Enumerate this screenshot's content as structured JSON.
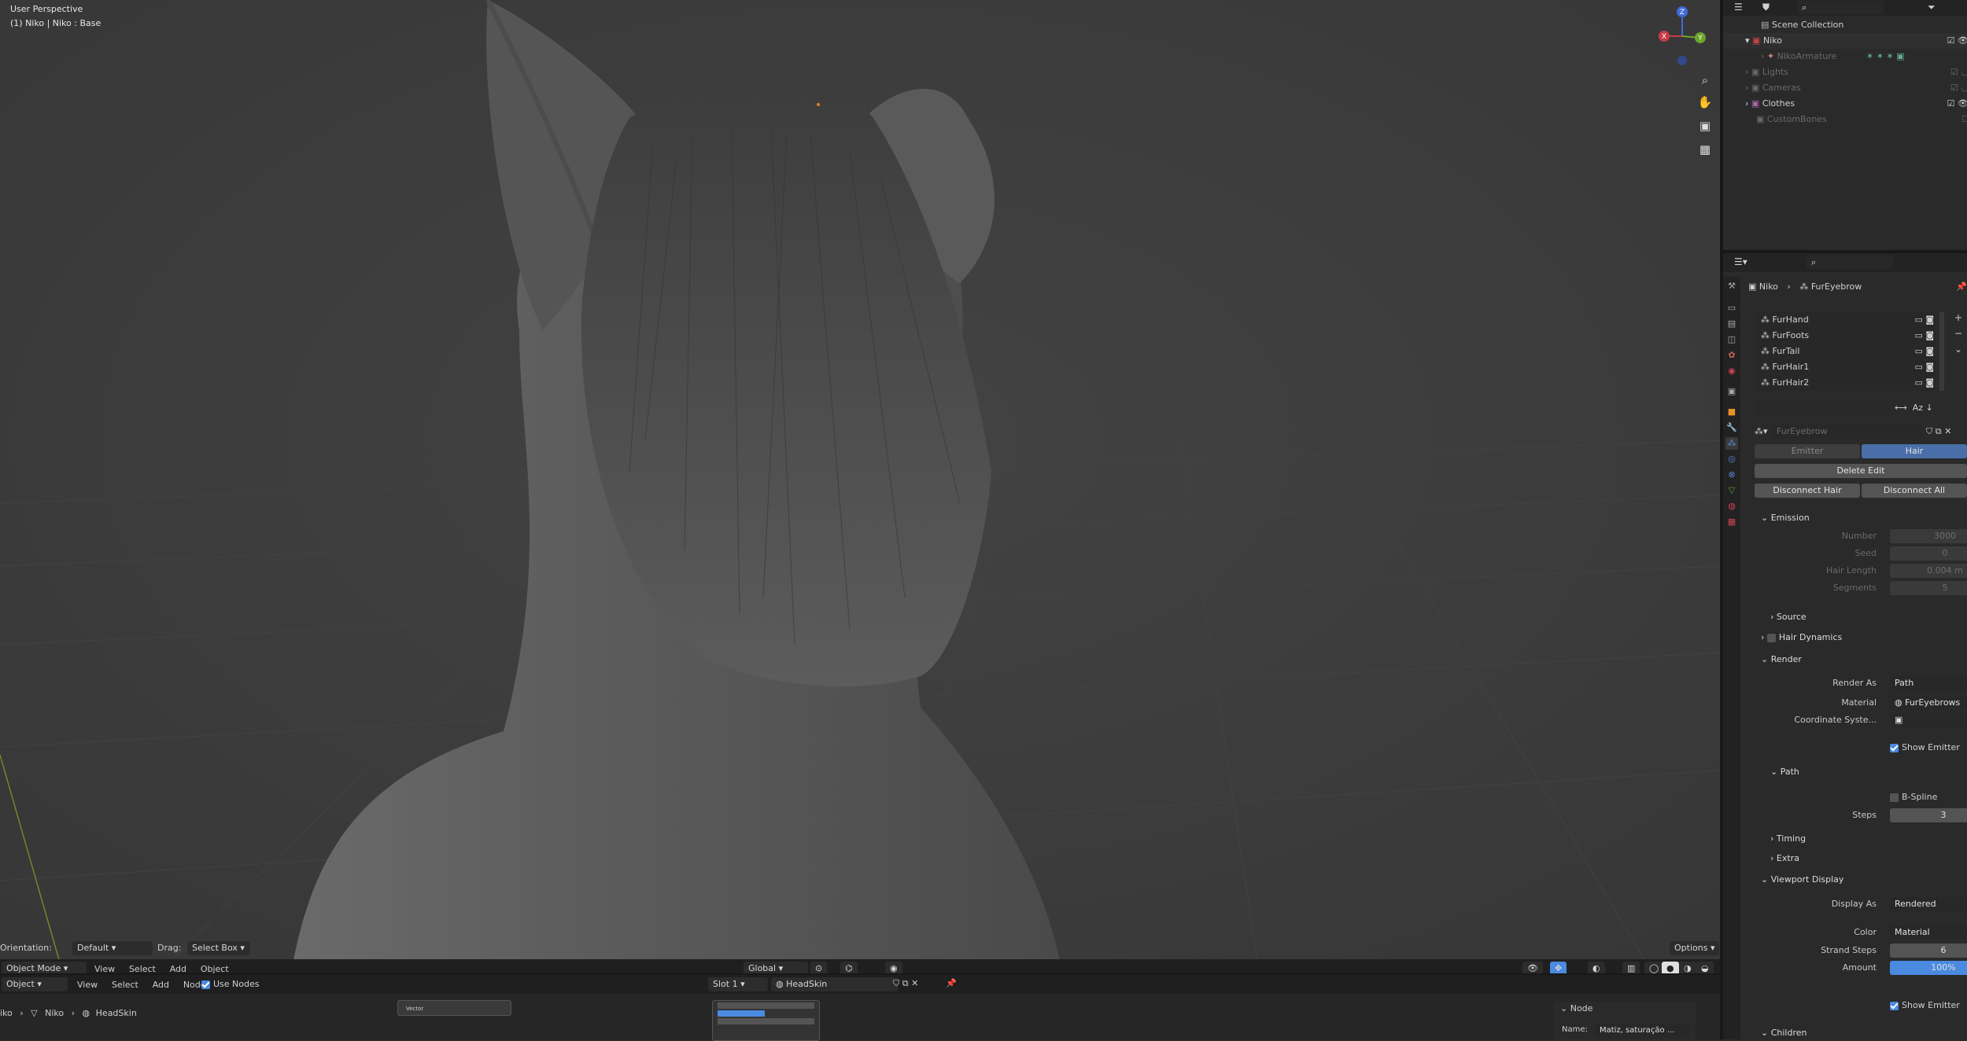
{
  "viewport": {
    "perspective_label": "User Perspective",
    "object_label": "(1) Niko | Niko : Base",
    "header": {
      "orientation_label": "Orientation:",
      "orientation_value": "Default",
      "drag_label": "Drag:",
      "drag_value": "Select Box",
      "options_label": "Options",
      "mode": "Object Mode",
      "menus": [
        "View",
        "Select",
        "Add",
        "Object"
      ],
      "transform_orientation": "Global"
    },
    "gizmo": {
      "z": "Z",
      "x": "X",
      "y": "Y"
    }
  },
  "outliner": {
    "scene_collection": "Scene Collection",
    "rows": [
      {
        "label": "Niko",
        "dim": false
      },
      {
        "label": "NikoArmature",
        "dim": true
      },
      {
        "label": "Lights",
        "dim": true
      },
      {
        "label": "Cameras",
        "dim": true
      },
      {
        "label": "Clothes",
        "dim": false
      },
      {
        "label": "CustomBones",
        "dim": true
      }
    ]
  },
  "properties": {
    "breadcrumb": {
      "object": "Niko",
      "system": "FurEyebrow"
    },
    "particle_list": [
      "FurHand",
      "FurFoots",
      "FurTail",
      "FurHair1",
      "FurHair2"
    ],
    "settings_name": "FurEyebrow",
    "type_tabs": {
      "emitter": "Emitter",
      "hair": "Hair"
    },
    "delete_edit": "Delete Edit",
    "disconnect_hair": "Disconnect Hair",
    "disconnect_all": "Disconnect All",
    "emission": {
      "title": "Emission",
      "number_label": "Number",
      "number_value": "3000",
      "seed_label": "Seed",
      "seed_value": "0",
      "hair_length_label": "Hair Length",
      "hair_length_value": "0.004 m",
      "segments_label": "Segments",
      "segments_value": "5"
    },
    "source": "Source",
    "hair_dynamics": "Hair Dynamics",
    "render": {
      "title": "Render",
      "render_as_label": "Render As",
      "render_as_value": "Path",
      "material_label": "Material",
      "material_value": "FurEyebrows",
      "coord_label": "Coordinate Syste...",
      "show_emitter": "Show Emitter",
      "path_title": "Path",
      "bspline": "B-Spline",
      "steps_label": "Steps",
      "steps_value": "3",
      "timing": "Timing",
      "extra": "Extra"
    },
    "viewport_display": {
      "title": "Viewport Display",
      "display_as_label": "Display As",
      "display_as_value": "Rendered",
      "color_label": "Color",
      "color_value": "Material",
      "strand_steps_label": "Strand Steps",
      "strand_steps_value": "6",
      "amount_label": "Amount",
      "amount_value": "100%",
      "show_emitter": "Show Emitter"
    },
    "children": "Children"
  },
  "node_editor": {
    "object_mode": "Object",
    "menus": [
      "View",
      "Select",
      "Add",
      "Node"
    ],
    "use_nodes": "Use Nodes",
    "slot": "Slot 1",
    "material": "HeadSkin",
    "breadcrumb": [
      "iko",
      "Niko",
      "HeadSkin"
    ],
    "node_node_label": "Vector",
    "node_panel_title": "Node",
    "node_name_label": "Name:",
    "node_name_value": "Matiz, saturação ..."
  },
  "colors": {
    "accent": "#4a8ae0",
    "viewport_bg": "#3d3d3d",
    "panel_bg": "#2a2a2a"
  }
}
